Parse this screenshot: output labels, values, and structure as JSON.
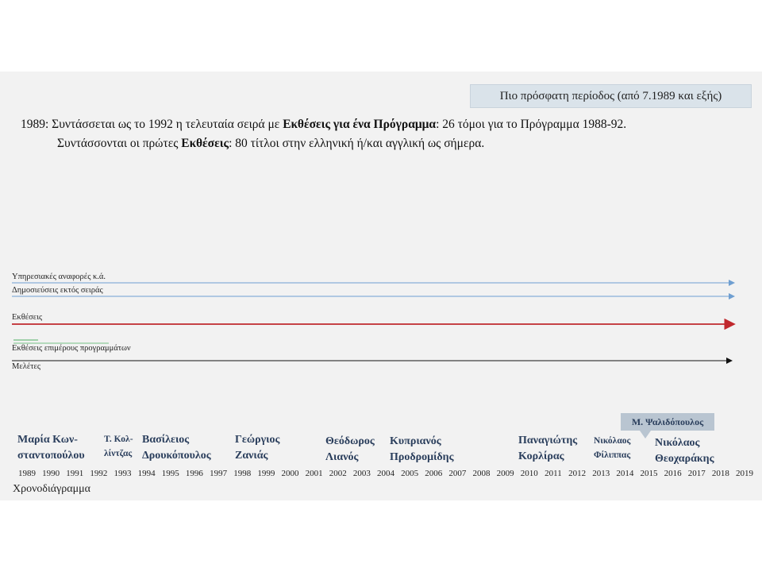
{
  "period_box": "Πιο πρόσφατη περίοδος (από 7.1989 και εξής)",
  "intro": {
    "line1": {
      "pre": "1989: Συντάσσεται ως το 1992 η τελευταία σειρά με ",
      "bold": "Εκθέσεις για ένα Πρόγραμμα",
      "post": ": 26 τόμοι για το Πρόγραμμα 1988-92."
    },
    "line2": {
      "pre": "Συντάσσονται οι πρώτες ",
      "bold": "Εκθέσεις",
      "post": ": 80 τίτλοι στην ελληνική ή/και αγγλική ως σήμερα."
    }
  },
  "tracks": [
    {
      "label": "Υπηρεσιακές αναφορές κ.ά.",
      "color": "#6f9fd1"
    },
    {
      "label": "Δημοσιεύσεις εκτός σειράς",
      "color": "#6f9fd1"
    },
    {
      "label": "Εκθέσεις",
      "color": "#c0282d"
    },
    {
      "label": "Εκθέσεις επιμέρους προγραμμάτων",
      "color": "#4caf62"
    },
    {
      "label": "Μελέτες",
      "color": "#111111"
    }
  ],
  "people": [
    {
      "line1": "Μαρία Κων-",
      "line2": "σταντοπούλου"
    },
    {
      "line1": "Τ. Κολ-",
      "line2": "λίντζας"
    },
    {
      "line1": "Βασίλειος",
      "line2": "Δρουκόπουλος"
    },
    {
      "line1": "Γεώργιος",
      "line2": "Ζανιάς"
    },
    {
      "line1": "Θεόδωρος",
      "line2": "Λιανός"
    },
    {
      "line1": "Κυπριανός",
      "line2": "Προδρομίδης"
    },
    {
      "line1": "Παναγιώτης",
      "line2": "Κορλίρας"
    },
    {
      "line1": "Νικόλαος",
      "line2": "Φίλιππας"
    },
    {
      "line1": "Νικόλαος",
      "line2": "Θεοχαράκης"
    }
  ],
  "callout": "Μ. Ψαλιδόπουλος",
  "years": [
    "1989",
    "1990",
    "1991",
    "1992",
    "1993",
    "1994",
    "1995",
    "1996",
    "1997",
    "1998",
    "1999",
    "2000",
    "2001",
    "2002",
    "2003",
    "2004",
    "2005",
    "2006",
    "2007",
    "2008",
    "2009",
    "2010",
    "2011",
    "2012",
    "2013",
    "2014",
    "2015",
    "2016",
    "2017",
    "2018",
    "2019"
  ],
  "timeline_caption": "Χρονοδιάγραμμα",
  "colors": {
    "slide_bg": "#f2f2f2",
    "name_color": "#2a3e5c",
    "box_bg": "#dae3ea",
    "callout_bg": "#b9c5d1"
  }
}
